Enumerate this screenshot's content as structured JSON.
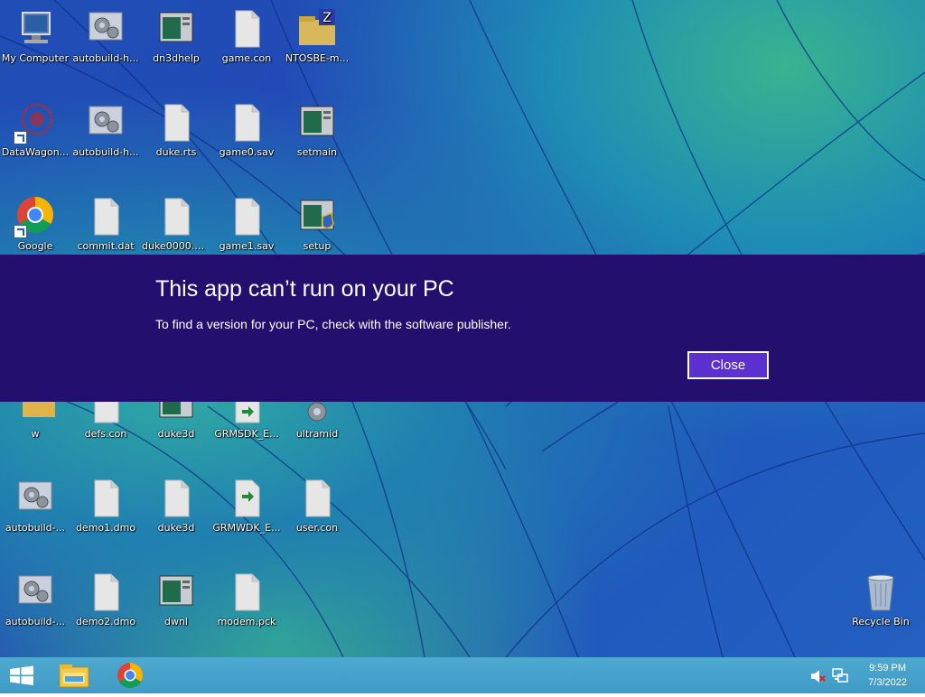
{
  "desktop": {
    "icons": [
      {
        "label": "My Computer",
        "icon": "computer-icon"
      },
      {
        "label": "autobuild-h...",
        "icon": "gear-app-icon"
      },
      {
        "label": "dn3dhelp",
        "icon": "window-app-icon"
      },
      {
        "label": "game.con",
        "icon": "document-icon"
      },
      {
        "label": "NTOSBE-m...",
        "icon": "archive-icon"
      },
      {
        "label": "DataWagon...",
        "icon": "datawagon-icon"
      },
      {
        "label": "autobuild-h...",
        "icon": "gear-app-icon"
      },
      {
        "label": "duke.rts",
        "icon": "document-icon"
      },
      {
        "label": "game0.sav",
        "icon": "document-icon"
      },
      {
        "label": "setmain",
        "icon": "window-app-icon"
      },
      {
        "label": "Google",
        "icon": "chrome-icon"
      },
      {
        "label": "commit.dat",
        "icon": "document-icon"
      },
      {
        "label": "duke0000.pcx",
        "icon": "document-icon"
      },
      {
        "label": "game1.sav",
        "icon": "document-icon"
      },
      {
        "label": "setup",
        "icon": "setup-icon"
      },
      {
        "label": "w",
        "icon": "folder-icon"
      },
      {
        "label": "defs.con",
        "icon": "document-icon"
      },
      {
        "label": "duke3d",
        "icon": "window-app-icon"
      },
      {
        "label": "GRMSDK_E...",
        "icon": "installer-icon"
      },
      {
        "label": "ultramid",
        "icon": "gear-app-icon"
      },
      {
        "label": "autobuild-...",
        "icon": "gear-app-icon"
      },
      {
        "label": "demo1.dmo",
        "icon": "document-icon"
      },
      {
        "label": "duke3d",
        "icon": "document-icon"
      },
      {
        "label": "GRMWDK_E...",
        "icon": "installer-icon"
      },
      {
        "label": "user.con",
        "icon": "document-icon"
      },
      {
        "label": "autobuild-...",
        "icon": "gear-app-icon"
      },
      {
        "label": "demo2.dmo",
        "icon": "document-icon"
      },
      {
        "label": "dwnl",
        "icon": "window-app-icon"
      },
      {
        "label": "modem.pck",
        "icon": "document-icon"
      },
      {
        "label": "Recycle Bin",
        "icon": "recycle-bin-icon"
      }
    ]
  },
  "dialog": {
    "title": "This app can’t run on your PC",
    "message": "To find a version for your PC, check with the software publisher.",
    "close_label": "Close"
  },
  "taskbar": {
    "start_icon": "windows-logo-icon",
    "pinned": [
      "file-explorer-icon",
      "chrome-icon"
    ],
    "tray_icons": [
      "volume-muted-icon",
      "network-icon"
    ],
    "time": "9:59 PM",
    "date": "7/3/2022"
  },
  "colors": {
    "dialog_bg": "#220f6e",
    "button_bg": "#5b2fd0",
    "taskbar_bg": "#3f9ac6"
  }
}
